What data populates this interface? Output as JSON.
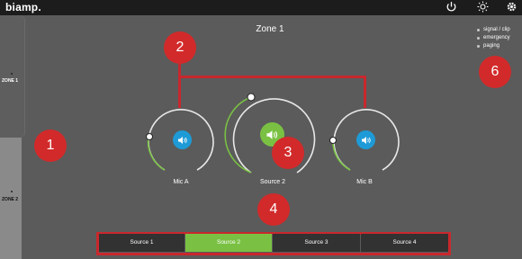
{
  "header": {
    "logo": "biamp."
  },
  "sidebar": {
    "zone1_label": "ZONE 1",
    "zone2_label": "ZONE 2"
  },
  "zone_title": "Zone 1",
  "legend": [
    "signal / clip",
    "emergency",
    "paging"
  ],
  "knobs": [
    {
      "label": "Mic A"
    },
    {
      "label": "Source 2"
    },
    {
      "label": "Mic B"
    }
  ],
  "sources": [
    "Source 1",
    "Source 2",
    "Source 3",
    "Source 4"
  ],
  "selected_source": "Source 2",
  "callouts": [
    "1",
    "2",
    "3",
    "4",
    "6"
  ],
  "colors": {
    "accent_green": "#7ac143",
    "accent_blue": "#1e9bd7",
    "callout_red": "#d22a2a"
  }
}
